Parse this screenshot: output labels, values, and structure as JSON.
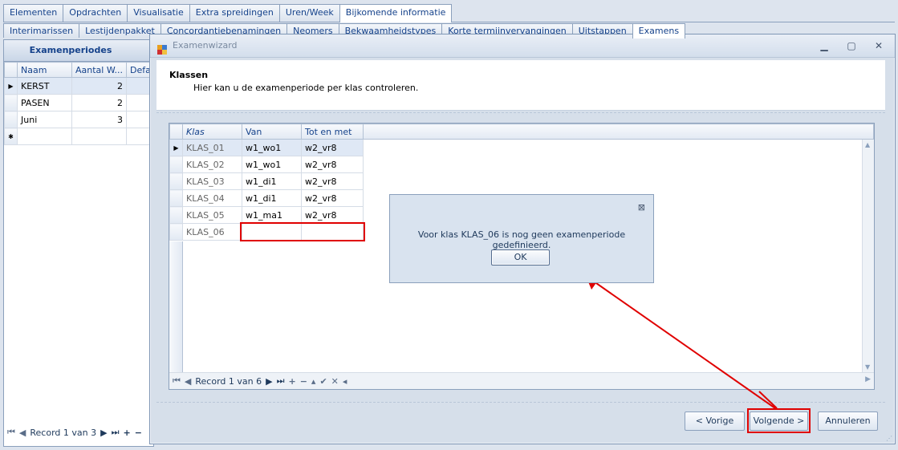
{
  "main_tabs": [
    "Elementen",
    "Opdrachten",
    "Visualisatie",
    "Extra spreidingen",
    "Uren/Week",
    "Bijkomende informatie"
  ],
  "sub_tabs": [
    "Interimarissen",
    "Lestijdenpakket",
    "Concordantiebenamingen",
    "Neomers",
    "Bekwaamheidstypes",
    "Korte termijnvervangingen",
    "Uitstappen",
    "Examens"
  ],
  "left_panel": {
    "title": "Examenperiodes",
    "columns": [
      "Naam",
      "Aantal W...",
      "Defau"
    ],
    "rows": [
      {
        "naam": "KERST",
        "aantal": "2"
      },
      {
        "naam": "PASEN",
        "aantal": "2"
      },
      {
        "naam": "Juni",
        "aantal": "3"
      }
    ],
    "new_row_marker": "✱",
    "record_text": "Record 1 van 3"
  },
  "wizard": {
    "title": "Examenwizard",
    "heading": "Klassen",
    "description": "Hier kan u de examenperiode per klas controleren.",
    "columns": [
      "Klas",
      "Van",
      "Tot en met"
    ],
    "rows": [
      {
        "klas": "KLAS_01",
        "van": "w1_wo1",
        "tot": "w2_vr8"
      },
      {
        "klas": "KLAS_02",
        "van": "w1_wo1",
        "tot": "w2_vr8"
      },
      {
        "klas": "KLAS_03",
        "van": "w1_di1",
        "tot": "w2_vr8"
      },
      {
        "klas": "KLAS_04",
        "van": "w1_di1",
        "tot": "w2_vr8"
      },
      {
        "klas": "KLAS_05",
        "van": "w1_ma1",
        "tot": "w2_vr8"
      },
      {
        "klas": "KLAS_06",
        "van": "",
        "tot": ""
      }
    ],
    "record_text": "Record 1 van 6",
    "buttons": {
      "prev": "< Vorige",
      "next": "Volgende >",
      "cancel": "Annuleren"
    }
  },
  "message_box": {
    "text": "Voor klas KLAS_06 is nog geen examenperiode gedefinieerd.",
    "ok": "OK"
  },
  "colors": {
    "highlight": "#e00000",
    "accent": "#15428b"
  }
}
